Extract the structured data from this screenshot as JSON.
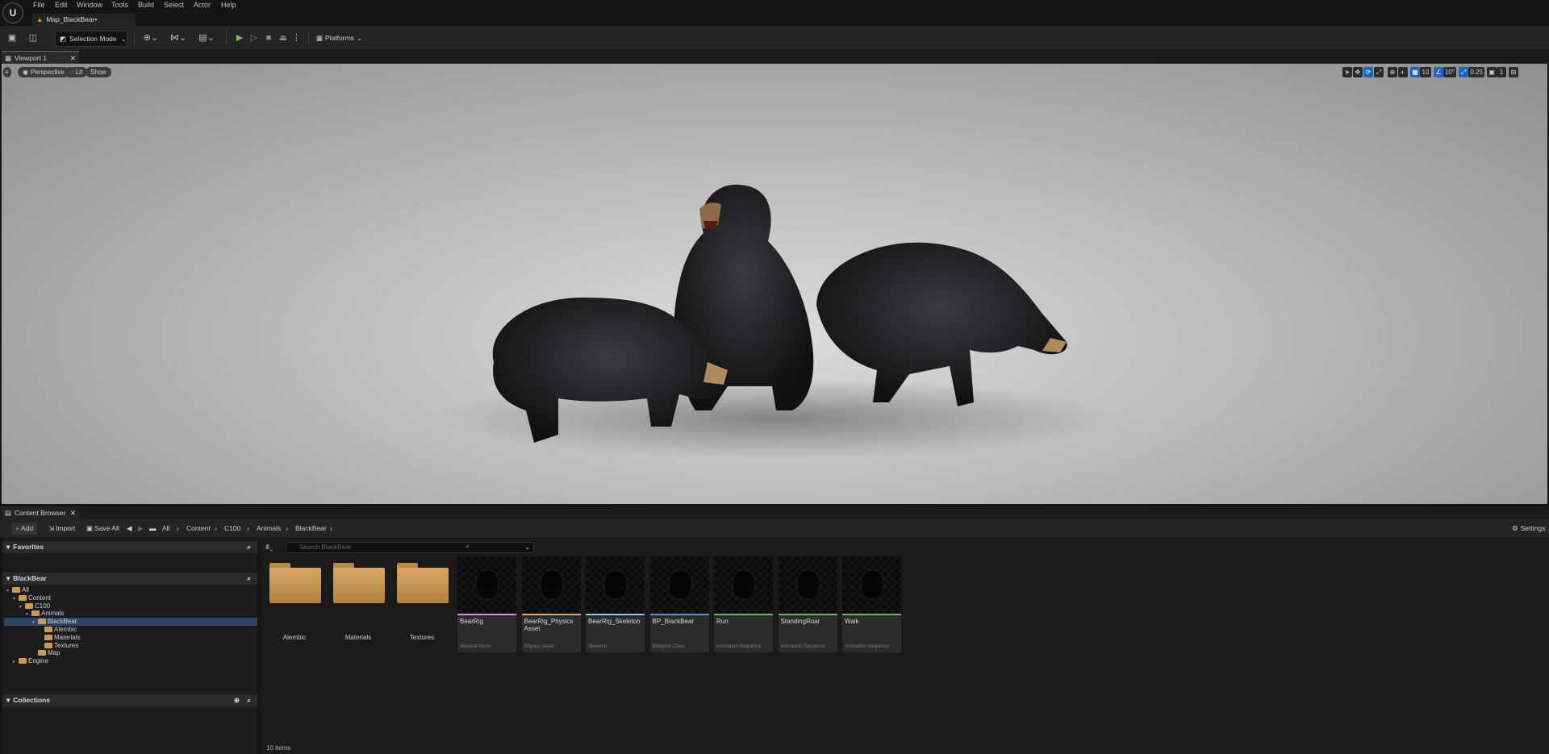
{
  "app": {
    "logo_text": "U"
  },
  "menu": [
    "File",
    "Edit",
    "Window",
    "Tools",
    "Build",
    "Select",
    "Actor",
    "Help"
  ],
  "map_tab": {
    "label": "Map_BlackBear•"
  },
  "toolbar": {
    "selection_mode": "Selection Mode",
    "platforms": "Platforms"
  },
  "viewport": {
    "tab_label": "Viewport 1",
    "perspective": "Perspective",
    "lit": "Lit",
    "show": "Show",
    "grid_snap": "10",
    "rotation_snap": "10°",
    "scale_snap": "0.25",
    "camera_speed": "1"
  },
  "content_browser": {
    "tab_label": "Content Browser",
    "add_label": "Add",
    "import_label": "Import",
    "save_all_label": "Save All",
    "breadcrumb": [
      "All",
      "Content",
      "C100",
      "Animals",
      "BlackBear"
    ],
    "settings_label": "Settings",
    "favorites_label": "Favorites",
    "path_section_label": "BlackBear",
    "collections_label": "Collections",
    "search_placeholder": "Search BlackBear",
    "item_count": "10 items",
    "tree": [
      {
        "label": "All",
        "depth": 0
      },
      {
        "label": "Content",
        "depth": 1
      },
      {
        "label": "C100",
        "depth": 2
      },
      {
        "label": "Animals",
        "depth": 3
      },
      {
        "label": "BlackBear",
        "depth": 4
      },
      {
        "label": "Alembic",
        "depth": 5
      },
      {
        "label": "Materials",
        "depth": 5
      },
      {
        "label": "Textures",
        "depth": 5
      },
      {
        "label": "Map",
        "depth": 4
      },
      {
        "label": "Engine",
        "depth": 1
      }
    ],
    "folders": [
      "Alembic",
      "Materials",
      "Textures"
    ],
    "assets": [
      {
        "name": "BearRig",
        "type": "Skeletal Mesh",
        "color": "#d78ee0"
      },
      {
        "name": "BearRig_Physics Asset",
        "type": "Physics Asset",
        "color": "#e0a070"
      },
      {
        "name": "BearRig_Skeleton",
        "type": "Skeleton",
        "color": "#8fc5e6"
      },
      {
        "name": "BP_BlackBear",
        "type": "Blueprint Class",
        "color": "#5f8fd8"
      },
      {
        "name": "Run",
        "type": "Animation Sequence",
        "color": "#6fb36f"
      },
      {
        "name": "StandingRoar",
        "type": "Animation Sequence",
        "color": "#6fb36f"
      },
      {
        "name": "Walk",
        "type": "Animation Sequence",
        "color": "#6fb36f"
      }
    ]
  }
}
